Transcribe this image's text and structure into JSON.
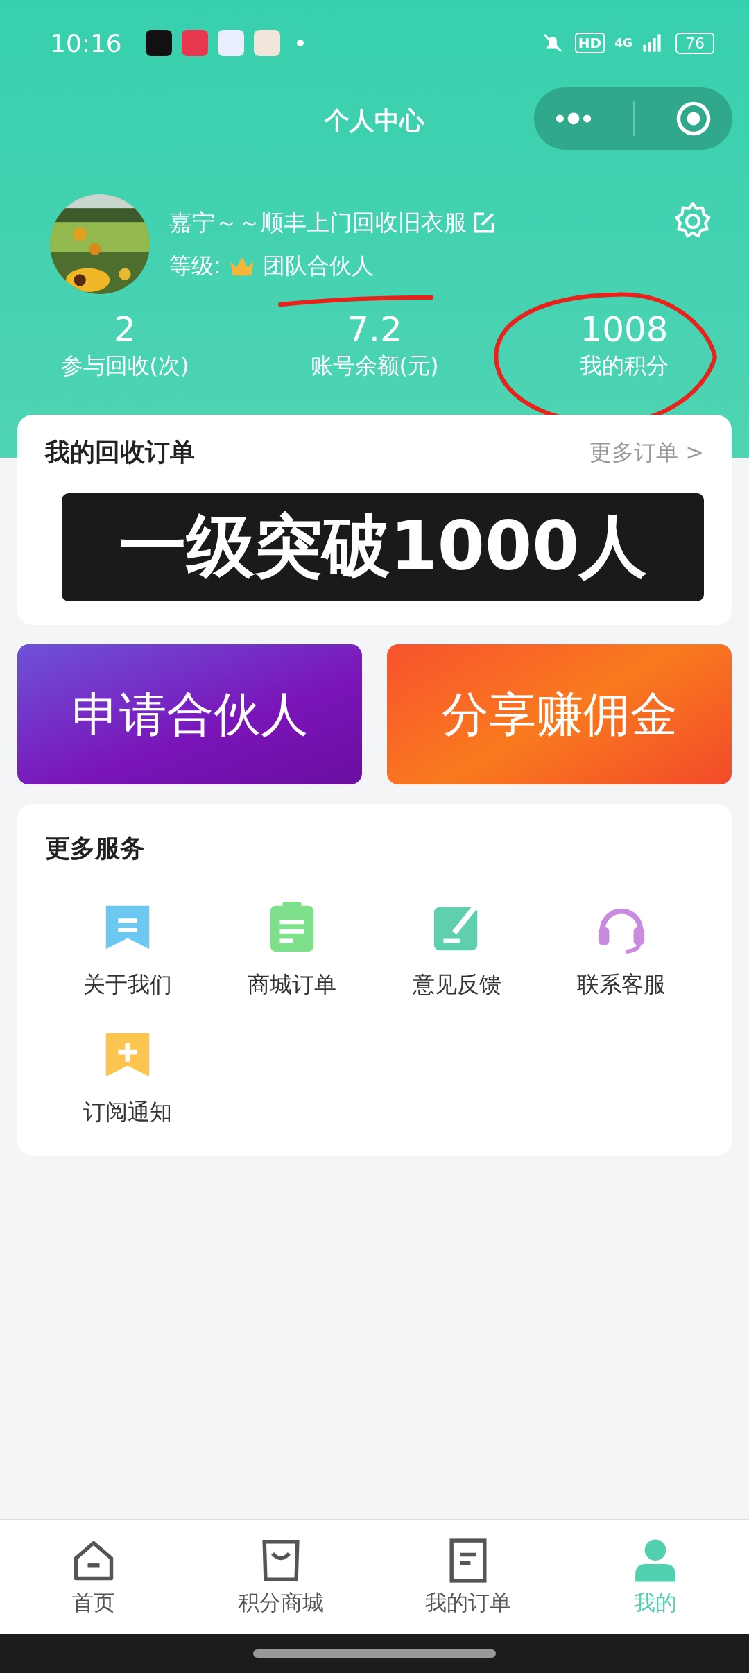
{
  "status_bar": {
    "time": "10:16",
    "network": "4G",
    "hd": "HD",
    "battery": "76"
  },
  "header": {
    "title": "个人中心"
  },
  "profile": {
    "name": "嘉宁～～顺丰上门回收旧衣服",
    "level_label": "等级:",
    "level": "团队合伙人"
  },
  "stats": [
    {
      "value": "2",
      "label": "参与回收(次)"
    },
    {
      "value": "7.2",
      "label": "账号余额(元)"
    },
    {
      "value": "1008",
      "label": "我的积分"
    }
  ],
  "orders": {
    "title": "我的回收订单",
    "more": "更多订单 >",
    "overlay": "一级突破1000人"
  },
  "banners": [
    {
      "kind": "purple",
      "label": "申请合伙人"
    },
    {
      "kind": "orange",
      "label": "分享赚佣金"
    }
  ],
  "services": {
    "title": "更多服务",
    "items": [
      {
        "kind": "about",
        "label": "关于我们"
      },
      {
        "kind": "mall-order",
        "label": "商城订单"
      },
      {
        "kind": "feedback",
        "label": "意见反馈"
      },
      {
        "kind": "support",
        "label": "联系客服"
      },
      {
        "kind": "subscribe",
        "label": "订阅通知"
      }
    ]
  },
  "tabs": [
    {
      "kind": "home",
      "label": "首页",
      "selected": false
    },
    {
      "kind": "bag",
      "label": "积分商城",
      "selected": false
    },
    {
      "kind": "doc",
      "label": "我的订单",
      "selected": false
    },
    {
      "kind": "user",
      "label": "我的",
      "selected": true
    }
  ]
}
